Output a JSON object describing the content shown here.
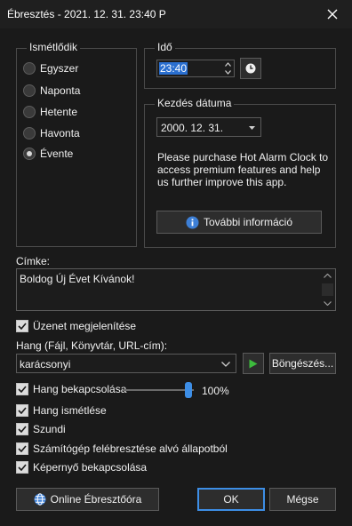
{
  "window": {
    "title": "Ébresztés - 2021. 12. 31. 23:40 P"
  },
  "repeat": {
    "legend": "Ismétlődik",
    "options": [
      {
        "label": "Egyszer",
        "checked": false
      },
      {
        "label": "Naponta",
        "checked": false
      },
      {
        "label": "Hetente",
        "checked": false
      },
      {
        "label": "Havonta",
        "checked": false
      },
      {
        "label": "Évente",
        "checked": true
      }
    ]
  },
  "time": {
    "legend": "Idő",
    "value": "23:40"
  },
  "start_date": {
    "legend": "Kezdés dátuma",
    "value": "2000. 12. 31.",
    "promo_text": "Please purchase Hot Alarm Clock to access premium features and help us further improve this app.",
    "more_info_label": "További információ"
  },
  "label_field": {
    "caption": "Címke:",
    "value": "Boldog Új Évet Kívánok!"
  },
  "show_message": {
    "label": "Üzenet megjelenítése",
    "checked": true
  },
  "sound": {
    "caption": "Hang (Fájl, Könyvtár, URL-cím):",
    "value": "karácsonyi",
    "browse_label": "Böngészés..."
  },
  "options": {
    "sound_enable": {
      "label": "Hang bekapcsolása",
      "checked": true,
      "volume_text": "100%",
      "volume": 1.0
    },
    "repeat_sound": {
      "label": "Hang ismétlése",
      "checked": true
    },
    "snooze": {
      "label": "Szundi",
      "checked": true
    },
    "wake_computer": {
      "label": "Számítógép felébresztése alvó állapotból",
      "checked": true
    },
    "screen_on": {
      "label": "Képernyő bekapcsolása",
      "checked": true
    }
  },
  "buttons": {
    "online": "Online Ébresztőóra",
    "ok": "OK",
    "cancel": "Mégse"
  },
  "colors": {
    "accent": "#3d8ee6",
    "play": "#3dbb3d",
    "info": "#3d7fd6",
    "background": "#1a1a1a"
  }
}
